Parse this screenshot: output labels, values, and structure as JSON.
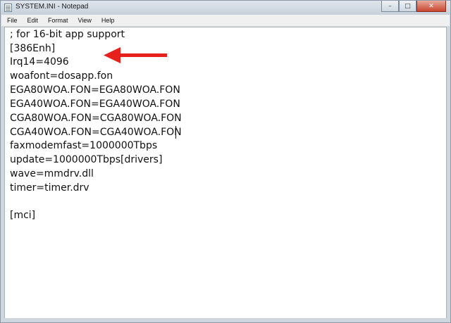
{
  "window": {
    "title": "SYSTEM.INI - Notepad",
    "controls": {
      "minimize": "–",
      "maximize": "□",
      "close": "✕"
    }
  },
  "menu": {
    "items": [
      "File",
      "Edit",
      "Format",
      "View",
      "Help"
    ]
  },
  "editor": {
    "lines": [
      "; for 16-bit app support",
      "[386Enh]",
      "Irq14=4096",
      "woafont=dosapp.fon",
      "EGA80WOA.FON=EGA80WOA.FON",
      "EGA40WOA.FON=EGA40WOA.FON",
      "CGA80WOA.FON=CGA80WOA.FON",
      "CGA40WOA.FON=CGA40WOA.FON",
      "faxmodemfast=1000000Tbps",
      "update=1000000Tbps[drivers]",
      "wave=mmdrv.dll",
      "timer=timer.drv",
      "",
      "[mci]"
    ]
  },
  "annotation": {
    "arrow_color": "#e8211c",
    "icon": "red-arrow-icon"
  }
}
